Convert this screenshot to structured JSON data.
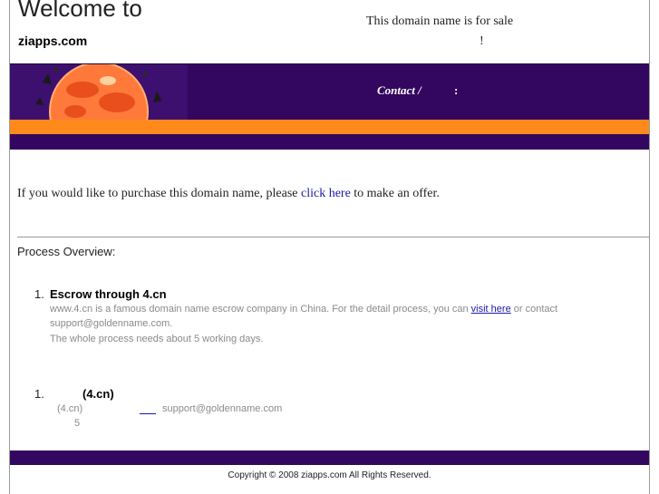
{
  "header": {
    "welcome": "Welcome to",
    "site_name": "ziapps.com",
    "for_sale": "This domain name is for sale",
    "exclaim": "!"
  },
  "banner": {
    "contact_label": "Contact /",
    "contact_colon": ":"
  },
  "offer": {
    "prefix": "If you would like to purchase this domain name, please ",
    "link_text": "click here",
    "suffix": " to make an offer."
  },
  "process": {
    "heading": "Process Overview:",
    "items": [
      {
        "number": "1.",
        "title": "Escrow through 4.cn",
        "line1_prefix": "www.4.cn is a famous domain name escrow company in China. For the detail process, you can ",
        "line1_link": "visit here",
        "line1_suffix": " or contact",
        "line2": "support@goldenname.com.",
        "line3": "The whole process needs about 5 working days."
      },
      {
        "number": "1.",
        "title": "(4.cn)",
        "line1_a": "(4.cn)",
        "line1_b": "support@goldenname.com",
        "line2": "5"
      }
    ]
  },
  "footer": {
    "copyright": "Copyright © 2008 ziapps.com All Rights Reserved."
  },
  "colors": {
    "banner_purple": "#33075f",
    "stripe_orange": "#ff8a1c",
    "link_blue": "#1a1aaa"
  }
}
